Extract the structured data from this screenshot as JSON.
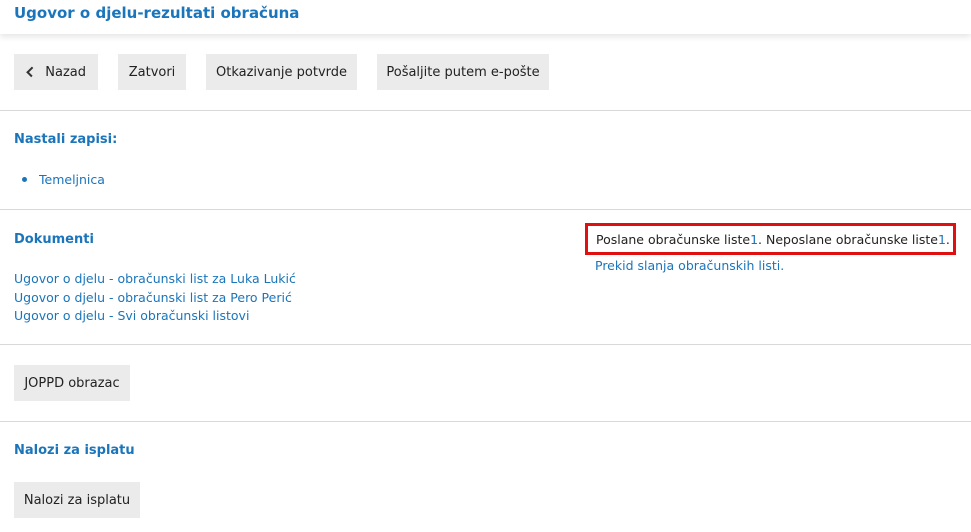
{
  "header": {
    "title": "Ugovor o djelu-rezultati obračuna"
  },
  "toolbar": {
    "back_label": "Nazad",
    "close_label": "Zatvori",
    "cancel_confirm_label": "Otkazivanje potvrde",
    "send_email_label": "Pošaljite putem e-pošte"
  },
  "records": {
    "title": "Nastali zapisi:",
    "items": [
      "Temeljnica"
    ]
  },
  "documents": {
    "title": "Dokumenti",
    "links": [
      "Ugovor o djelu - obračunski list za Luka Lukić",
      "Ugovor o djelu - obračunski list za Pero Perić",
      "Ugovor o djelu - Svi obračunski listovi"
    ],
    "notice": {
      "sent_text": "Poslane obračunske liste ",
      "sent_count": "1",
      "unsent_text": ". Neposlane obračunske liste ",
      "unsent_count": "1",
      "end": "."
    },
    "stop_link": "Prekid slanja obračunskih listi."
  },
  "joppd": {
    "button_label": "JOPPD obrazac"
  },
  "payments": {
    "title": "Nalozi za isplatu",
    "button_label": "Nalozi za isplatu"
  }
}
